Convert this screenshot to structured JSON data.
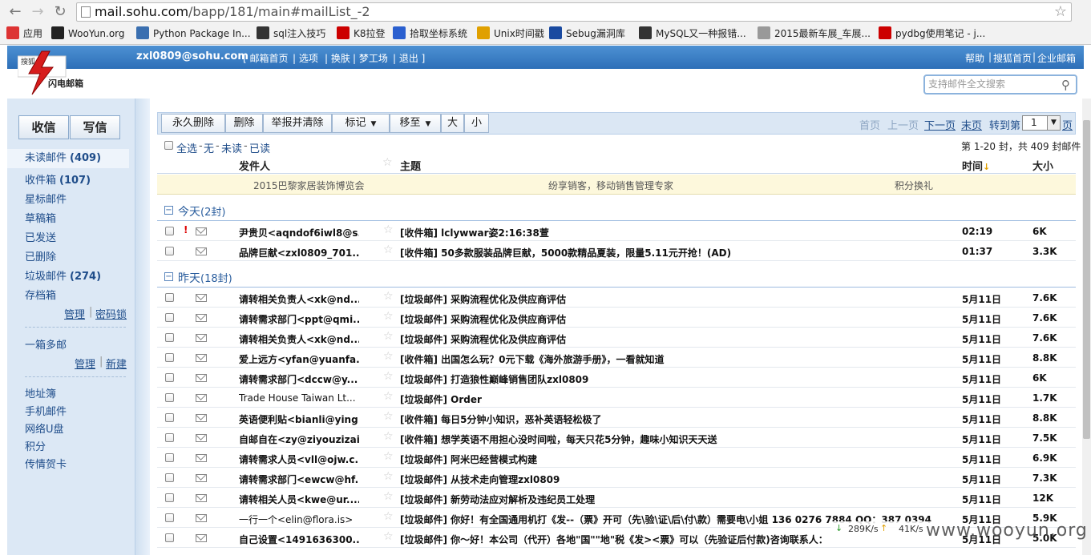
{
  "browser": {
    "url_host": "mail.sohu.com",
    "url_path": "/bapp/181/main#mailList_-2",
    "bookmarks": [
      {
        "label": "应用",
        "color": "#d33"
      },
      {
        "label": "WooYun.org",
        "color": "#222"
      },
      {
        "label": "Python Package In...",
        "color": "#3a6fb0"
      },
      {
        "label": "sql注入技巧",
        "color": "#333"
      },
      {
        "label": "K8拉登",
        "color": "#c00"
      },
      {
        "label": "拾取坐标系统",
        "color": "#2a5fcf"
      },
      {
        "label": "Unix时间戳",
        "color": "#e0a000"
      },
      {
        "label": "Sebug漏洞库",
        "color": "#1a4aa0"
      },
      {
        "label": "MySQL又一种报错...",
        "color": "#333"
      },
      {
        "label": "2015最新车展_车展...",
        "color": "#999"
      },
      {
        "label": "pydbg使用笔记 - j...",
        "color": "#c00"
      }
    ]
  },
  "header": {
    "logo_text": "搜狐闪电邮箱",
    "user_email": "zxl0809@sohu.com",
    "nav": [
      "[ 邮箱首页",
      "| 选项",
      "| 换肤",
      "| 梦工场",
      "| 退出 ]"
    ],
    "right_links": [
      "帮助",
      "|",
      "搜狐首页",
      "|",
      "企业邮箱"
    ],
    "search_placeholder": "支持邮件全文搜索"
  },
  "sidebar": {
    "receive_label": "收信",
    "compose_label": "写信",
    "folders": [
      {
        "label": "未读邮件",
        "count": "(409)"
      },
      {
        "label": "收件箱",
        "count": "(107)"
      },
      {
        "label": "星标邮件",
        "count": ""
      },
      {
        "label": "草稿箱",
        "count": ""
      },
      {
        "label": "已发送",
        "count": ""
      },
      {
        "label": "已删除",
        "count": ""
      },
      {
        "label": "垃圾邮件",
        "count": "(274)"
      },
      {
        "label": "存档箱",
        "count": ""
      }
    ],
    "manage_label": "管理",
    "lock_label": "密码锁",
    "multi_box_label": "一箱多邮",
    "manage2_label": "管理",
    "new_label": "新建",
    "tools": [
      "地址簿",
      "手机邮件",
      "网络U盘",
      "积分",
      "传情贺卡"
    ]
  },
  "toolbar": {
    "buttons": [
      "永久删除",
      "删除",
      "举报并清除",
      "标记",
      "移至",
      "大",
      "小"
    ],
    "pager": {
      "first": "首页",
      "prev": "上一页",
      "next": "下一页",
      "last": "末页",
      "goto": "转到第",
      "page_value": "1",
      "page_suffix": "页"
    }
  },
  "selection": {
    "all": "全选",
    "none": "无",
    "unread": "未读",
    "read": "已读",
    "count_text": "第 1-20 封，共 409 封邮件"
  },
  "columns": {
    "from": "发件人",
    "subject": "主题",
    "time": "时间",
    "size": "大小"
  },
  "ad": {
    "left": "2015巴黎家居装饰博览会",
    "middle": "纷享销客，移动销售管理专家",
    "right": "积分换礼"
  },
  "groups": [
    {
      "label": "今天",
      "count": "(2封)"
    },
    {
      "label": "昨天",
      "count": "(18封)"
    }
  ],
  "mails_today": [
    {
      "from": "尹贵贝<aqndof6iwl8@s...",
      "subject": "[收件箱] lclywwar姿2:16:38萱",
      "time": "02:19",
      "size": "6K",
      "important": "!"
    },
    {
      "from": "品牌巨献<zxl0809_701...",
      "subject": "[收件箱] 50多款服装品牌巨献，5000款精品夏装，限量5.11元开抢！(AD)",
      "time": "01:37",
      "size": "3.3K",
      "important": ""
    }
  ],
  "mails_yesterday": [
    {
      "from": "请转相关负责人<xk@nd...",
      "subject": "[垃圾邮件] 采购流程优化及供应商评估",
      "time": "5月11日",
      "size": "7.6K"
    },
    {
      "from": "请转需求部门<ppt@qmi...",
      "subject": "[垃圾邮件] 采购流程优化及供应商评估",
      "time": "5月11日",
      "size": "7.6K"
    },
    {
      "from": "请转相关负责人<xk@nd...",
      "subject": "[垃圾邮件] 采购流程优化及供应商评估",
      "time": "5月11日",
      "size": "7.6K"
    },
    {
      "from": "爱上远方<yfan@yuanfa...",
      "subject": "[收件箱] 出国怎么玩？0元下载《海外旅游手册》，一看就知道",
      "time": "5月11日",
      "size": "8.8K"
    },
    {
      "from": "请转需求部门<dccw@y...",
      "subject": "[垃圾邮件] 打造狼性巅峰销售团队zxl0809",
      "time": "5月11日",
      "size": "6K"
    },
    {
      "from": "Trade House Taiwan Lt...",
      "subject": "[垃圾邮件] Order",
      "time": "5月11日",
      "size": "1.7K"
    },
    {
      "from": "英语便利贴<bianli@ying...",
      "subject": "[收件箱] 每日5分钟小知识，恶补英语轻松极了",
      "time": "5月11日",
      "size": "8.8K"
    },
    {
      "from": "自邮自在<zy@ziyouzizai...",
      "subject": "[收件箱] 想学英语不用担心没时间啦，每天只花5分钟，趣味小知识天天送",
      "time": "5月11日",
      "size": "7.5K"
    },
    {
      "from": "请转需求人员<vll@ojw.c...",
      "subject": "[垃圾邮件] 阿米巴经营模式构建",
      "time": "5月11日",
      "size": "6.9K"
    },
    {
      "from": "请转需求部门<ewcw@hf...",
      "subject": "[垃圾邮件] 从技术走向管理zxl0809",
      "time": "5月11日",
      "size": "7.3K"
    },
    {
      "from": "请转相关人员<kwe@ur....",
      "subject": "[垃圾邮件] 新劳动法应对解析及违纪员工处理",
      "time": "5月11日",
      "size": "12K"
    },
    {
      "from": "一行一个<elin@flora.is>",
      "subject": "[垃圾邮件] 你好！有全国通用机打《发--（票》开可（先\\验\\证\\后\\付\\款）需要电\\小姐 136 0276 7884 QQ：387 0394",
      "time": "5月11日",
      "size": "5.9K"
    },
    {
      "from": "自己设置<1491636300...",
      "subject": "[垃圾邮件] 你～好！本公司（代开）各地\"国\"\"地\"税《发><票》可以（先验证后付款)咨询联系人：",
      "time": "5月11日",
      "size": "5.0K"
    }
  ],
  "status": {
    "down": "289K/s",
    "up": "41K/s"
  },
  "watermark": "www.wooyun.org"
}
